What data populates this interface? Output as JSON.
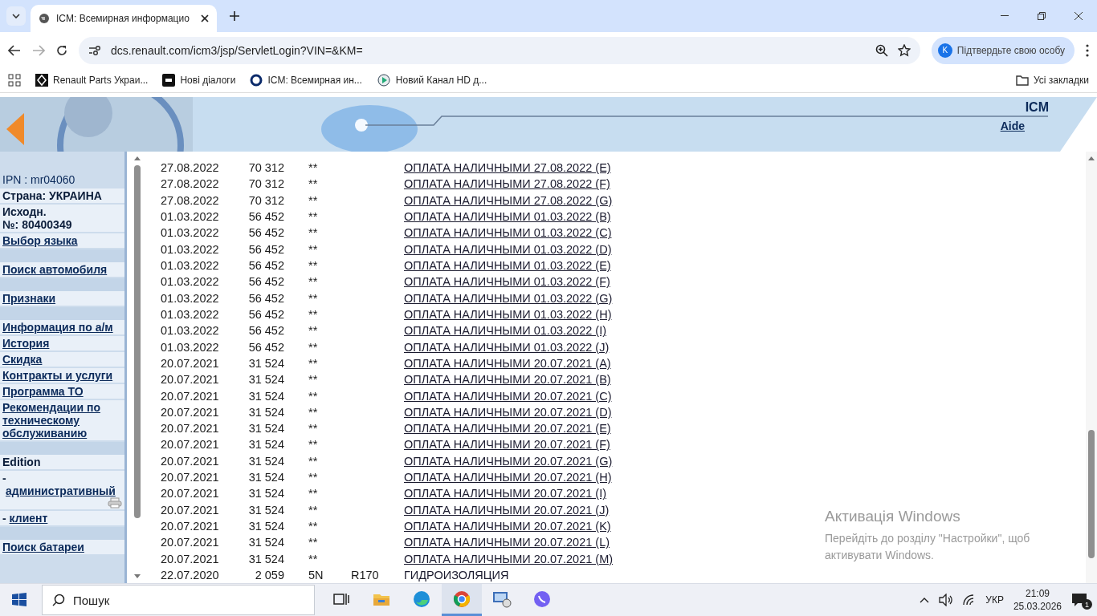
{
  "browser": {
    "tab_title": "ICM: Всемирная информацио",
    "address": "dcs.renault.com/icm3/jsp/ServletLogin?VIN=&KM=",
    "profile_text": "Підтвердьте свою особу",
    "profile_initial": "K",
    "bookmarks": [
      {
        "label": "Renault Parts Украи...",
        "kind": "renault"
      },
      {
        "label": "Нові діалоги",
        "kind": "rg"
      },
      {
        "label": "ICM: Всемирная ин...",
        "kind": "ring"
      },
      {
        "label": "Новий Канал HD д...",
        "kind": "play"
      }
    ],
    "all_bookmarks": "Усі закладки"
  },
  "header": {
    "title": "ICM",
    "help_link": "Aide"
  },
  "sidebar": [
    {
      "kind": "plain",
      "text": "IPN : mr04060"
    },
    {
      "kind": "bold",
      "text": "Страна: УКРАИНА",
      "gap_before": false
    },
    {
      "kind": "bold",
      "text": "Исходн.",
      "second_line": "№: 80400349",
      "gap_before": false
    },
    {
      "kind": "link",
      "text": "Выбор языка",
      "gap_before": false
    },
    {
      "kind": "link",
      "text": "Поиск  автомобиля",
      "gap_before": true
    },
    {
      "kind": "link",
      "text": "Признаки",
      "gap_before": true
    },
    {
      "kind": "link",
      "text": "Информация по а/м",
      "gap_before": true
    },
    {
      "kind": "link",
      "text": "История",
      "gap_before": false
    },
    {
      "kind": "link",
      "text": "Скидка",
      "gap_before": false
    },
    {
      "kind": "link",
      "text": "Контракты и услуги",
      "gap_before": false
    },
    {
      "kind": "link",
      "text": "Программа ТО",
      "gap_before": false
    },
    {
      "kind": "link",
      "text": "Рекомендации по техническому обслуживанию",
      "gap_before": false
    },
    {
      "kind": "bold",
      "text": "Edition",
      "gap_before": true
    },
    {
      "kind": "sublink",
      "prefix": "-",
      "text": "административный",
      "printer": true,
      "gap_before": false
    },
    {
      "kind": "sublink",
      "prefix": "-",
      "text": "клиент",
      "printer": false,
      "gap_before": false
    },
    {
      "kind": "link",
      "text": "Поиск батареи",
      "gap_before": true
    }
  ],
  "rows": [
    {
      "date": "27.08.2022",
      "km": "70 312",
      "code": "**",
      "description": "ОПЛАТА НАЛИЧНЫМИ 27.08.2022 (E)",
      "link": true
    },
    {
      "date": "27.08.2022",
      "km": "70 312",
      "code": "**",
      "description": "ОПЛАТА НАЛИЧНЫМИ 27.08.2022 (F)",
      "link": true
    },
    {
      "date": "27.08.2022",
      "km": "70 312",
      "code": "**",
      "description": "ОПЛАТА НАЛИЧНЫМИ 27.08.2022 (G)",
      "link": true
    },
    {
      "date": "01.03.2022",
      "km": "56 452",
      "code": "**",
      "description": "ОПЛАТА НАЛИЧНЫМИ 01.03.2022 (B)",
      "link": true
    },
    {
      "date": "01.03.2022",
      "km": "56 452",
      "code": "**",
      "description": "ОПЛАТА НАЛИЧНЫМИ 01.03.2022 (C)",
      "link": true
    },
    {
      "date": "01.03.2022",
      "km": "56 452",
      "code": "**",
      "description": "ОПЛАТА НАЛИЧНЫМИ 01.03.2022 (D)",
      "link": true
    },
    {
      "date": "01.03.2022",
      "km": "56 452",
      "code": "**",
      "description": "ОПЛАТА НАЛИЧНЫМИ 01.03.2022 (E)",
      "link": true
    },
    {
      "date": "01.03.2022",
      "km": "56 452",
      "code": "**",
      "description": "ОПЛАТА НАЛИЧНЫМИ 01.03.2022 (F)",
      "link": true
    },
    {
      "date": "01.03.2022",
      "km": "56 452",
      "code": "**",
      "description": "ОПЛАТА НАЛИЧНЫМИ 01.03.2022 (G)",
      "link": true
    },
    {
      "date": "01.03.2022",
      "km": "56 452",
      "code": "**",
      "description": "ОПЛАТА НАЛИЧНЫМИ 01.03.2022 (H)",
      "link": true
    },
    {
      "date": "01.03.2022",
      "km": "56 452",
      "code": "**",
      "description": "ОПЛАТА НАЛИЧНЫМИ 01.03.2022 (I)",
      "link": true
    },
    {
      "date": "01.03.2022",
      "km": "56 452",
      "code": "**",
      "description": "ОПЛАТА НАЛИЧНЫМИ 01.03.2022 (J)",
      "link": true
    },
    {
      "date": "20.07.2021",
      "km": "31 524",
      "code": "**",
      "description": "ОПЛАТА НАЛИЧНЫМИ 20.07.2021 (A)",
      "link": true
    },
    {
      "date": "20.07.2021",
      "km": "31 524",
      "code": "**",
      "description": "ОПЛАТА НАЛИЧНЫМИ 20.07.2021 (B)",
      "link": true
    },
    {
      "date": "20.07.2021",
      "km": "31 524",
      "code": "**",
      "description": "ОПЛАТА НАЛИЧНЫМИ 20.07.2021 (C)",
      "link": true
    },
    {
      "date": "20.07.2021",
      "km": "31 524",
      "code": "**",
      "description": "ОПЛАТА НАЛИЧНЫМИ 20.07.2021 (D)",
      "link": true
    },
    {
      "date": "20.07.2021",
      "km": "31 524",
      "code": "**",
      "description": "ОПЛАТА НАЛИЧНЫМИ 20.07.2021 (E)",
      "link": true
    },
    {
      "date": "20.07.2021",
      "km": "31 524",
      "code": "**",
      "description": "ОПЛАТА НАЛИЧНЫМИ 20.07.2021 (F)",
      "link": true
    },
    {
      "date": "20.07.2021",
      "km": "31 524",
      "code": "**",
      "description": "ОПЛАТА НАЛИЧНЫМИ 20.07.2021 (G)",
      "link": true
    },
    {
      "date": "20.07.2021",
      "km": "31 524",
      "code": "**",
      "description": "ОПЛАТА НАЛИЧНЫМИ 20.07.2021 (H)",
      "link": true
    },
    {
      "date": "20.07.2021",
      "km": "31 524",
      "code": "**",
      "description": "ОПЛАТА НАЛИЧНЫМИ 20.07.2021 (I)",
      "link": true
    },
    {
      "date": "20.07.2021",
      "km": "31 524",
      "code": "**",
      "description": "ОПЛАТА НАЛИЧНЫМИ 20.07.2021 (J)",
      "link": true
    },
    {
      "date": "20.07.2021",
      "km": "31 524",
      "code": "**",
      "description": "ОПЛАТА НАЛИЧНЫМИ 20.07.2021 (K)",
      "link": true
    },
    {
      "date": "20.07.2021",
      "km": "31 524",
      "code": "**",
      "description": "ОПЛАТА НАЛИЧНЫМИ 20.07.2021 (L)",
      "link": true
    },
    {
      "date": "20.07.2021",
      "km": "31 524",
      "code": "**",
      "description": "ОПЛАТА НАЛИЧНЫМИ 20.07.2021 (M)",
      "link": true
    },
    {
      "date": "22.07.2020",
      "km": "2 059",
      "code": "5N",
      "ref": "R170",
      "description": "ГИДРОИЗОЛЯЦИЯ",
      "link": false
    }
  ],
  "activation": {
    "title": "Активація Windows",
    "text": "Перейдіть до розділу \"Настройки\", щоб активувати Windows."
  },
  "taskbar": {
    "search_placeholder": "Пошук",
    "apps": [
      {
        "kind": "taskview",
        "selected": false
      },
      {
        "kind": "explorer",
        "selected": false
      },
      {
        "kind": "edge",
        "selected": false
      },
      {
        "kind": "chrome",
        "selected": true
      },
      {
        "kind": "remote",
        "selected": false
      },
      {
        "kind": "viber",
        "selected": false
      }
    ],
    "language": "УКР",
    "time": "21:09",
    "date": "25.03.2026",
    "notifications": "1"
  }
}
